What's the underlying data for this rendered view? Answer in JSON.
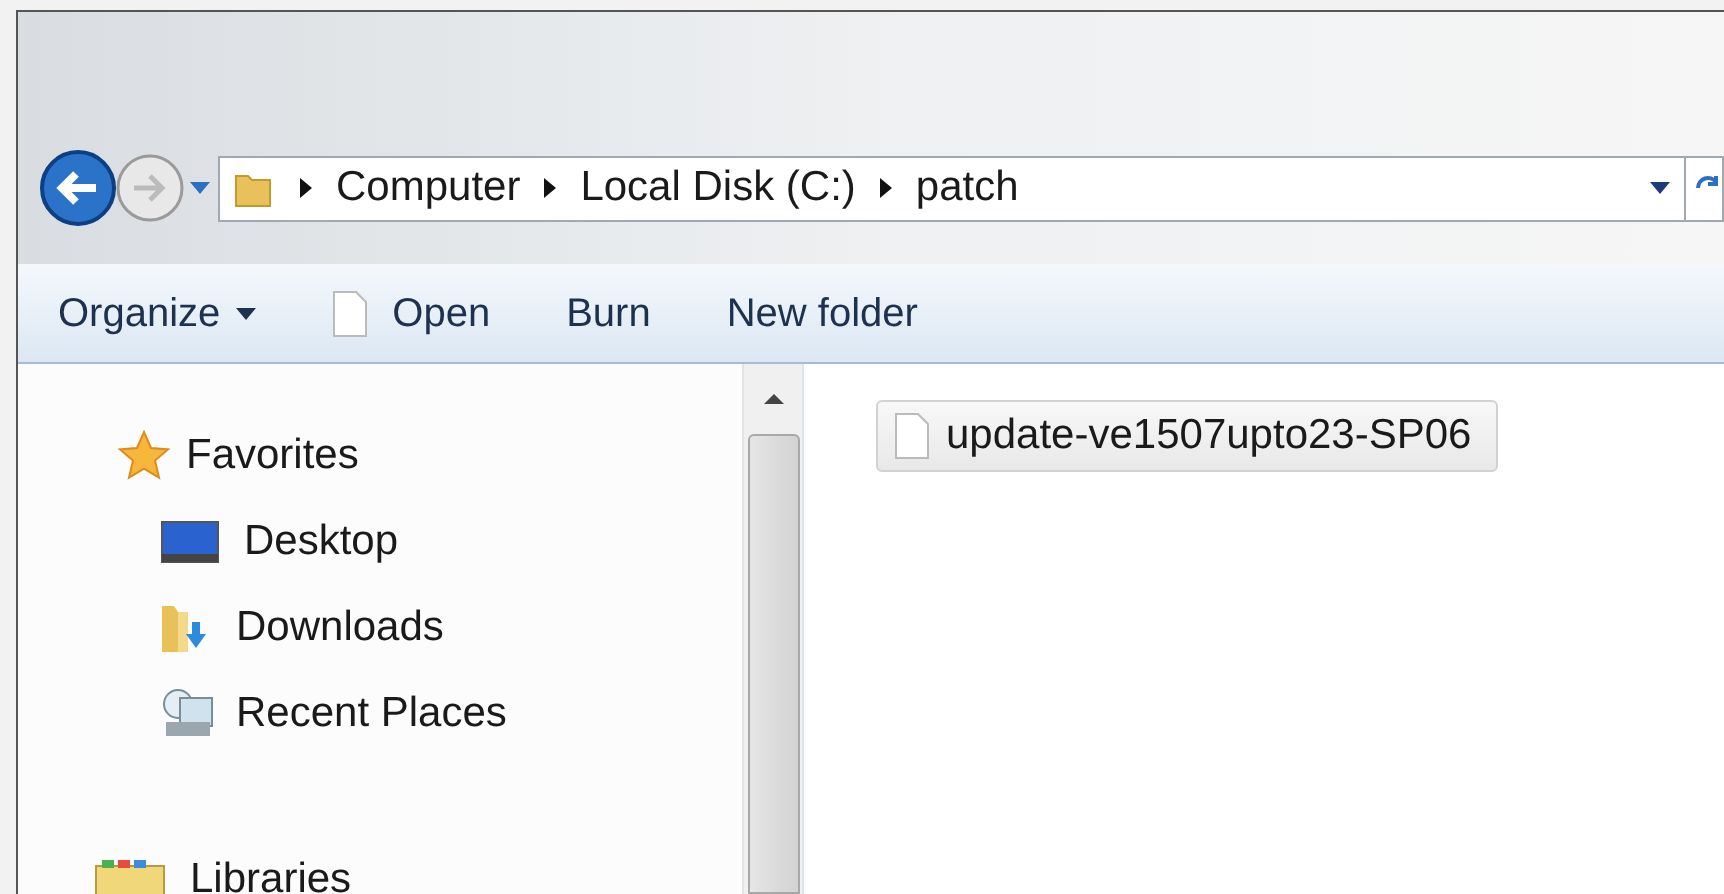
{
  "address_bar": {
    "breadcrumbs": [
      "Computer",
      "Local Disk (C:)",
      "patch"
    ]
  },
  "toolbar": {
    "buttons": [
      {
        "label": "Organize",
        "kind": "menu"
      },
      {
        "label": "Open",
        "kind": "open"
      },
      {
        "label": "Burn",
        "kind": "plain"
      },
      {
        "label": "New folder",
        "kind": "plain"
      }
    ]
  },
  "sidebar": {
    "items": [
      {
        "label": "Favorites",
        "kind": "star",
        "children": [
          {
            "label": "Desktop",
            "kind": "desktop"
          },
          {
            "label": "Downloads",
            "kind": "downloads"
          },
          {
            "label": "Recent Places",
            "kind": "recent"
          }
        ]
      },
      {
        "label": "Libraries",
        "kind": "libraries"
      }
    ]
  },
  "files": [
    {
      "name": "update-ve1507upto23-SP06",
      "selected": true
    }
  ]
}
